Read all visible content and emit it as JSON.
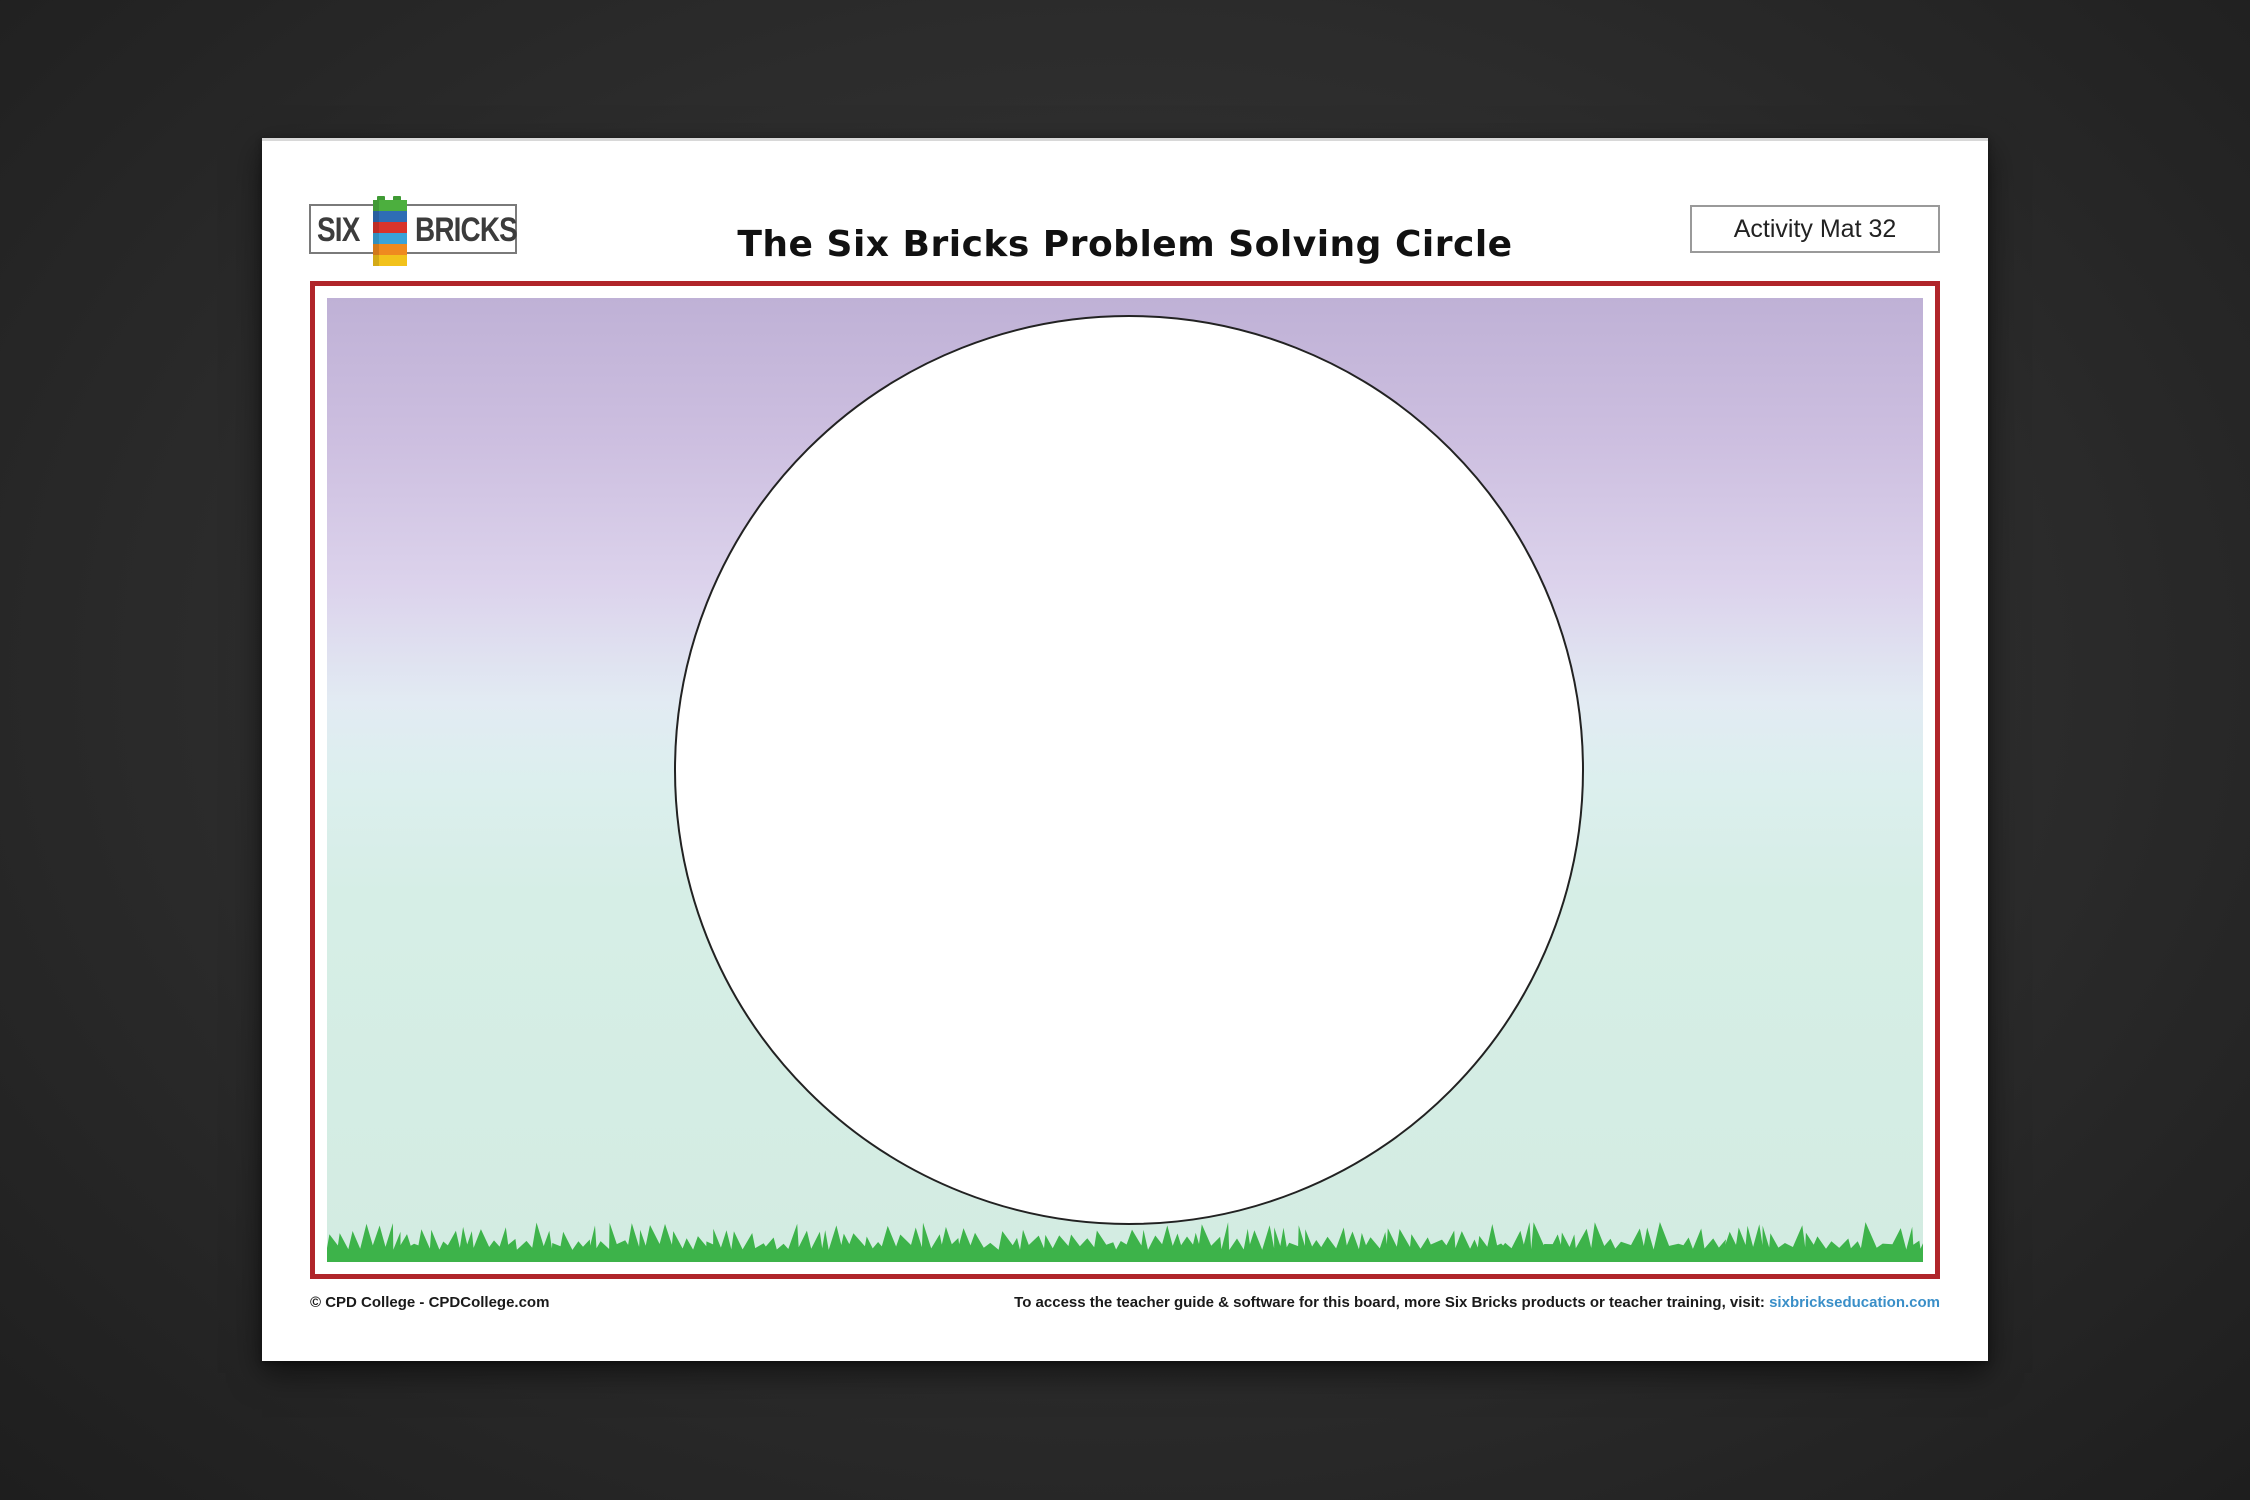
{
  "sheet": {
    "logo": {
      "word_left": "SIX",
      "word_right": "BRICKS",
      "brick_colors": [
        "#4caf3e",
        "#2e6db5",
        "#d9342b",
        "#f2c21b",
        "#ef8a1f",
        "#3aa3d9"
      ]
    },
    "title": "The Six Bricks Problem Solving Circle",
    "mat_label": "Activity Mat 32",
    "frame_color": "#b0252a",
    "sky_colors": [
      "#bfb1d6",
      "#dcd3ec",
      "#d3ece2"
    ],
    "grass_color": "#3db34a",
    "footer": {
      "copyright": "© CPD College - CPDCollege.com",
      "access_text": "To access the teacher guide & software for this board, more Six Bricks products or teacher training, visit: ",
      "link_text": "sixbrickseducation.com"
    }
  }
}
